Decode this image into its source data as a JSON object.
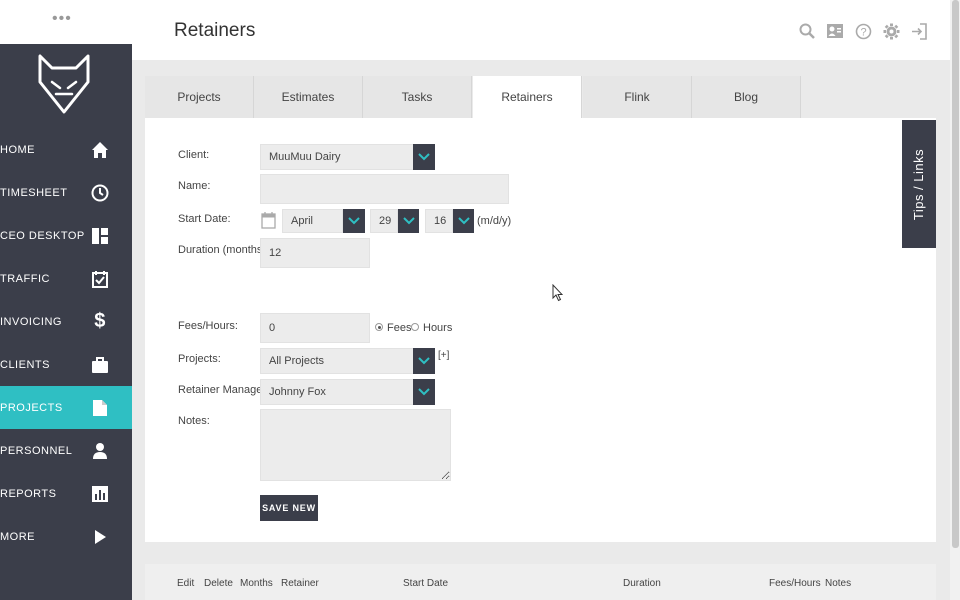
{
  "header": {
    "title": "Retainers",
    "icons": [
      "search-icon",
      "contact-card-icon",
      "help-icon",
      "gear-icon",
      "logout-icon"
    ]
  },
  "sidebar": {
    "items": [
      {
        "label": "HOME",
        "icon": "home-icon"
      },
      {
        "label": "TIMESHEET",
        "icon": "clock-icon"
      },
      {
        "label": "CEO DESKTOP",
        "icon": "dashboard-icon"
      },
      {
        "label": "TRAFFIC",
        "icon": "calendar-check-icon"
      },
      {
        "label": "INVOICING",
        "icon": "dollar-icon"
      },
      {
        "label": "CLIENTS",
        "icon": "briefcase-icon"
      },
      {
        "label": "PROJECTS",
        "icon": "document-icon"
      },
      {
        "label": "PERSONNEL",
        "icon": "person-icon"
      },
      {
        "label": "REPORTS",
        "icon": "bar-chart-icon"
      },
      {
        "label": "MORE",
        "icon": "play-icon"
      }
    ],
    "active_item": "PROJECTS"
  },
  "tabs": [
    "Projects",
    "Estimates",
    "Tasks",
    "Retainers",
    "Flink",
    "Blog"
  ],
  "active_tab": "Retainers",
  "tips_label": "Tips / Links",
  "form": {
    "client_label": "Client:",
    "client_value": "MuuMuu Dairy",
    "name_label": "Name:",
    "name_value": "",
    "start_date_label": "Start Date:",
    "month_value": "April",
    "day_value": "29",
    "year_value": "16",
    "date_format": "(m/d/y)",
    "duration_label": "Duration (months):",
    "duration_value": "12",
    "fees_label": "Fees/Hours:",
    "fees_value": "0",
    "fees_option": "Fees",
    "hours_option": "Hours",
    "selected_option": "Fees",
    "projects_label": "Projects:",
    "projects_value": "All Projects",
    "projects_add": "[+]",
    "manager_label": "Retainer Manager:",
    "manager_value": "Johnny Fox",
    "notes_label": "Notes:",
    "notes_value": "",
    "save_label": "SAVE NEW"
  },
  "table": {
    "columns": [
      "Edit",
      "Delete",
      "Months",
      "Retainer",
      "Start Date",
      "Duration",
      "Fees/Hours",
      "Notes"
    ]
  },
  "colors": {
    "sidebar_bg": "#3b3e4a",
    "accent": "#2fbfc3"
  }
}
